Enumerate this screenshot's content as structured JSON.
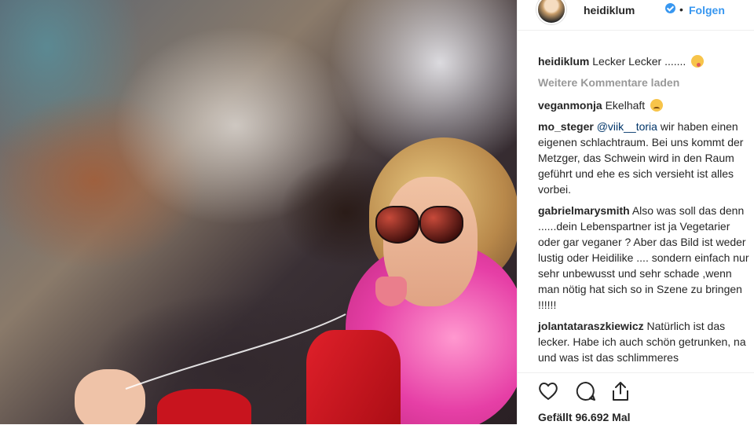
{
  "post": {
    "username": "heidiklum",
    "follow_label": "Folgen",
    "separator": "•"
  },
  "caption": {
    "user": "heidiklum",
    "text": "Lecker Lecker ....... "
  },
  "load_more_label": "Weitere Kommentare laden",
  "comments": [
    {
      "user": "veganmonja",
      "text": "Ekelhaft "
    },
    {
      "user": "mo_steger",
      "mention": "@viik__toria",
      "text": " wir haben einen eigenen schlachtraum. Bei uns kommt der Metzger, das Schwein wird in den Raum geführt und ehe es sich versieht ist alles vorbei."
    },
    {
      "user": "gabrielmarysmith",
      "text": "Also was soll das denn ......dein Lebenspartner ist ja Vegetarier oder gar veganer ? Aber das Bild ist weder lustig oder Heidilike .... sondern einfach nur sehr unbewusst und sehr schade ,wenn man nötig hat sich so in Szene zu bringen !!!!!!"
    },
    {
      "user": "jolantataraszkiewicz",
      "text": "Natürlich ist das lecker. Habe ich auch schön getrunken, na und was ist das schlimmeres"
    }
  ],
  "likes_label": "Gefällt 96.692 Mal",
  "icons": {
    "like": "heart-icon",
    "comment": "comment-bubble-icon",
    "share": "share-icon",
    "verified": "verified-badge-icon"
  },
  "colors": {
    "link_blue": "#3897f0",
    "muted_gray": "#999999",
    "text": "#262626"
  }
}
